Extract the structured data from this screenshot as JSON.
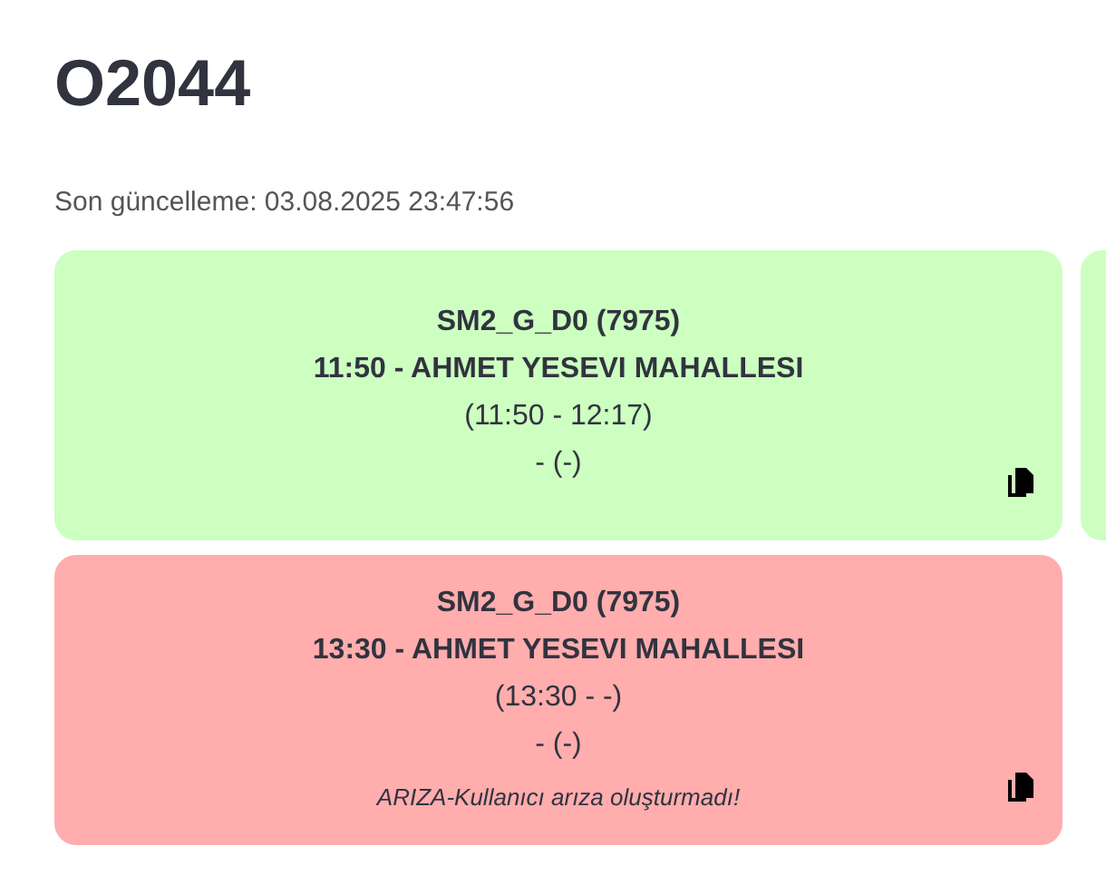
{
  "title": "O2044",
  "last_update": "Son güncelleme: 03.08.2025 23:47:56",
  "card_rows": [
    {
      "cards": [
        {
          "color": "#ccffc0",
          "vehicle": "SM2_G_D0 (7975)",
          "trip": "11:50 - AHMET YESEVI MAHALLESI",
          "times": "(11:50 - 12:17)",
          "driver": "- (-)"
        },
        {
          "color": "#ccffc0"
        }
      ]
    },
    {
      "cards": [
        {
          "color": "#ffadad",
          "vehicle": "SM2_G_D0 (7975)",
          "trip": "13:30 - AHMET YESEVI MAHALLESI",
          "times": "(13:30 - -)",
          "driver": "- (-)",
          "note": "ARIZA-Kullanıcı arıza oluşturmadı!"
        }
      ]
    }
  ]
}
